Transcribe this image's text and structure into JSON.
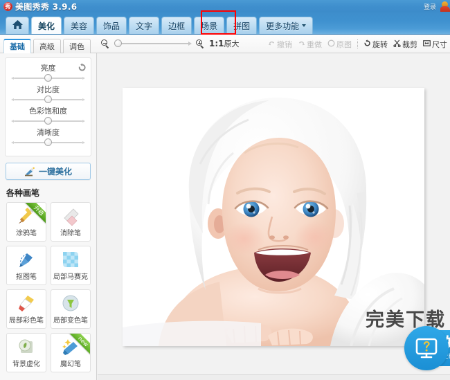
{
  "app": {
    "title": "美图秀秀 3.9.6",
    "logo_text": "秀",
    "logo_icon": "app-logo-icon",
    "login_label": "登录",
    "user_icon": "user-avatar-icon"
  },
  "main_tabs": [
    {
      "label": "",
      "icon": "home-icon",
      "name": "home",
      "active": false
    },
    {
      "label": "美化",
      "name": "beautify",
      "active": true
    },
    {
      "label": "美容",
      "name": "beauty",
      "active": false
    },
    {
      "label": "饰品",
      "name": "ornament",
      "active": false
    },
    {
      "label": "文字",
      "name": "text",
      "active": false
    },
    {
      "label": "边框",
      "name": "frame",
      "active": false
    },
    {
      "label": "场景",
      "name": "scene",
      "active": false,
      "highlighted": true
    },
    {
      "label": "拼图",
      "name": "collage",
      "active": false
    },
    {
      "label": "更多功能",
      "name": "more",
      "active": false,
      "caret": true
    }
  ],
  "annotation": {
    "color": "#ff0000",
    "target": "场景"
  },
  "subbar": {
    "subtabs": [
      {
        "label": "基础",
        "name": "basic",
        "active": true
      },
      {
        "label": "高级",
        "name": "advanced",
        "active": false
      },
      {
        "label": "调色",
        "name": "color-adjust",
        "active": false
      }
    ],
    "zoom": {
      "out_icon": "zoom-out-icon",
      "in_icon": "zoom-in-icon",
      "ratio": "1:1",
      "word": "原大",
      "knob_percent": 0
    },
    "tools": [
      {
        "label": "撤销",
        "name": "undo",
        "icon": "undo-arrow-icon",
        "disabled": true
      },
      {
        "label": "重做",
        "name": "redo",
        "icon": "redo-arrow-icon",
        "disabled": true
      },
      {
        "label": "原图",
        "name": "original",
        "icon": "circle-icon",
        "disabled": true
      },
      {
        "label": "旋转",
        "name": "rotate",
        "icon": "rotate-icon",
        "disabled": false
      },
      {
        "label": "裁剪",
        "name": "crop",
        "icon": "scissors-icon",
        "disabled": false
      },
      {
        "label": "尺寸",
        "name": "resize",
        "icon": "resize-icon",
        "disabled": false
      }
    ]
  },
  "left_panel": {
    "reset_icon": "reset-circle-icon",
    "sliders": [
      {
        "label": "亮度",
        "name": "brightness",
        "value_percent": 50
      },
      {
        "label": "对比度",
        "name": "contrast",
        "value_percent": 50
      },
      {
        "label": "色彩饱和度",
        "name": "saturation",
        "value_percent": 50
      },
      {
        "label": "清晰度",
        "name": "sharpness",
        "value_percent": 50
      }
    ],
    "beautify_button": {
      "label": "一键美化",
      "icon": "magic-wand-icon"
    },
    "brush_section_title": "各种画笔",
    "brushes": [
      {
        "label": "涂鸦笔",
        "name": "doodle-brush",
        "icon": "paintbrush-icon",
        "badge": "升级"
      },
      {
        "label": "消除笔",
        "name": "eraser-brush",
        "icon": "eraser-icon",
        "badge": ""
      },
      {
        "label": "抠图笔",
        "name": "cutout-brush",
        "icon": "cutout-pen-icon",
        "badge": ""
      },
      {
        "label": "局部马赛克",
        "name": "local-mosaic",
        "icon": "mosaic-icon",
        "badge": ""
      },
      {
        "label": "局部彩色笔",
        "name": "local-color-brush",
        "icon": "color-brush-icon",
        "badge": ""
      },
      {
        "label": "局部变色笔",
        "name": "local-hue-brush",
        "icon": "hue-brush-icon",
        "badge": ""
      },
      {
        "label": "背景虚化",
        "name": "background-blur",
        "icon": "blur-icon",
        "badge": ""
      },
      {
        "label": "魔幻笔",
        "name": "magic-brush",
        "icon": "magic-pen-icon",
        "badge": "new"
      }
    ]
  },
  "canvas": {
    "photo_alt": "smiling-baby-with-white-towel"
  },
  "watermark": {
    "background_text": "完美下载",
    "brand_cn": "知识屋",
    "brand_url": "zhishiwu.com",
    "icon": "monitor-question-icon",
    "color": "#1f9ad6"
  }
}
